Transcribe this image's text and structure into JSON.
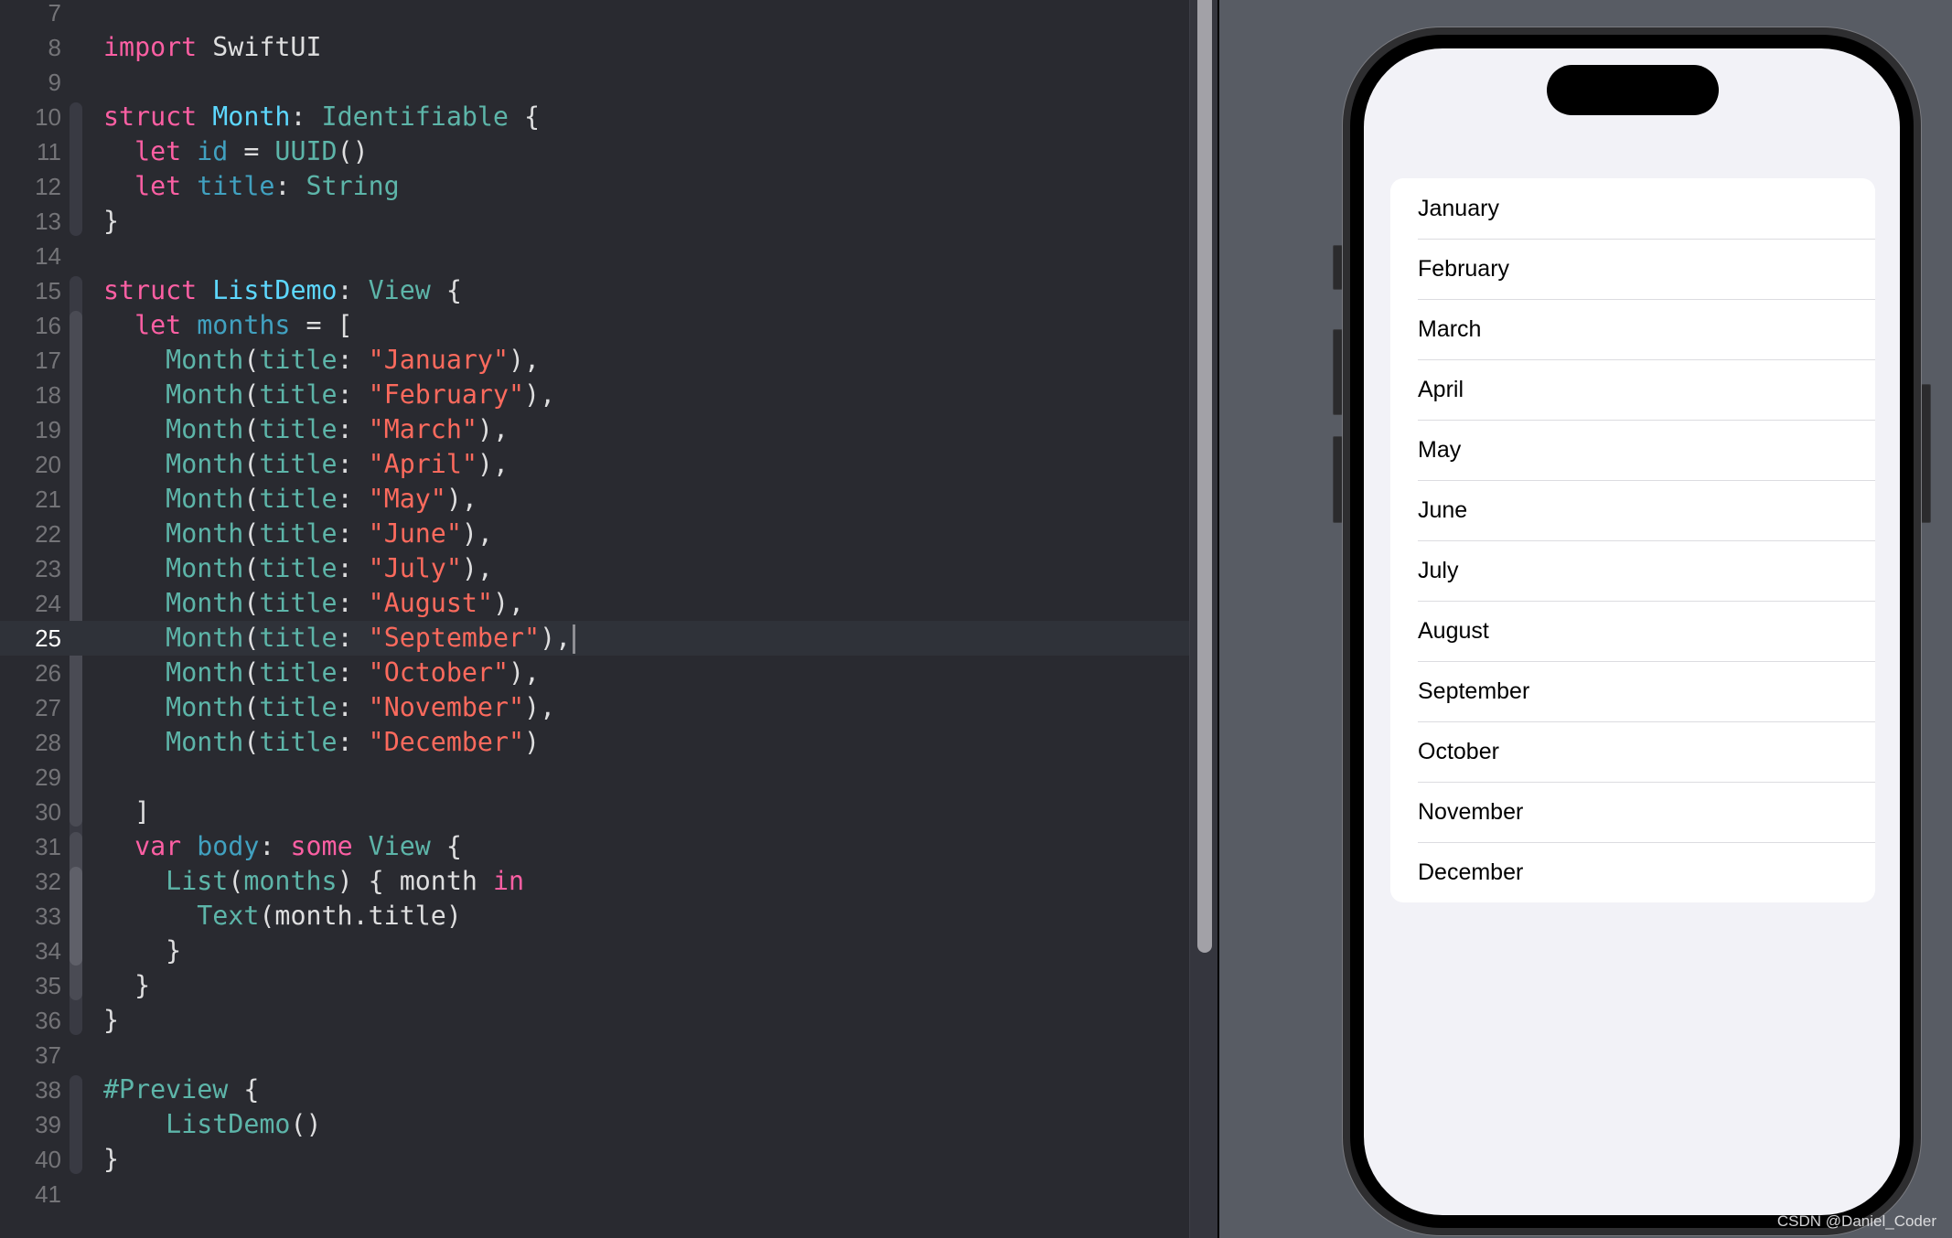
{
  "editor": {
    "current_line": 25,
    "lines": [
      {
        "n": 7,
        "tokens": []
      },
      {
        "n": 8,
        "tokens": [
          [
            "kw",
            "import"
          ],
          [
            "plain",
            " SwiftUI"
          ]
        ]
      },
      {
        "n": 9,
        "tokens": []
      },
      {
        "n": 10,
        "tokens": [
          [
            "kw",
            "struct"
          ],
          [
            "plain",
            " "
          ],
          [
            "decl",
            "Month"
          ],
          [
            "plain",
            ": "
          ],
          [
            "type",
            "Identifiable"
          ],
          [
            "plain",
            " {"
          ]
        ]
      },
      {
        "n": 11,
        "tokens": [
          [
            "plain",
            "  "
          ],
          [
            "kw",
            "let"
          ],
          [
            "plain",
            " "
          ],
          [
            "prop",
            "id"
          ],
          [
            "plain",
            " = "
          ],
          [
            "type",
            "UUID"
          ],
          [
            "plain",
            "()"
          ]
        ]
      },
      {
        "n": 12,
        "tokens": [
          [
            "plain",
            "  "
          ],
          [
            "kw",
            "let"
          ],
          [
            "plain",
            " "
          ],
          [
            "prop",
            "title"
          ],
          [
            "plain",
            ": "
          ],
          [
            "type",
            "String"
          ]
        ]
      },
      {
        "n": 13,
        "tokens": [
          [
            "plain",
            "}"
          ]
        ]
      },
      {
        "n": 14,
        "tokens": []
      },
      {
        "n": 15,
        "tokens": [
          [
            "kw",
            "struct"
          ],
          [
            "plain",
            " "
          ],
          [
            "decl",
            "ListDemo"
          ],
          [
            "plain",
            ": "
          ],
          [
            "type",
            "View"
          ],
          [
            "plain",
            " {"
          ]
        ]
      },
      {
        "n": 16,
        "tokens": [
          [
            "plain",
            "  "
          ],
          [
            "kw",
            "let"
          ],
          [
            "plain",
            " "
          ],
          [
            "prop",
            "months"
          ],
          [
            "plain",
            " = ["
          ]
        ]
      },
      {
        "n": 17,
        "tokens": [
          [
            "plain",
            "    "
          ],
          [
            "type",
            "Month"
          ],
          [
            "plain",
            "("
          ],
          [
            "type",
            "title"
          ],
          [
            "plain",
            ": "
          ],
          [
            "str",
            "\"January\""
          ],
          [
            "plain",
            "),"
          ]
        ]
      },
      {
        "n": 18,
        "tokens": [
          [
            "plain",
            "    "
          ],
          [
            "type",
            "Month"
          ],
          [
            "plain",
            "("
          ],
          [
            "type",
            "title"
          ],
          [
            "plain",
            ": "
          ],
          [
            "str",
            "\"February\""
          ],
          [
            "plain",
            "),"
          ]
        ]
      },
      {
        "n": 19,
        "tokens": [
          [
            "plain",
            "    "
          ],
          [
            "type",
            "Month"
          ],
          [
            "plain",
            "("
          ],
          [
            "type",
            "title"
          ],
          [
            "plain",
            ": "
          ],
          [
            "str",
            "\"March\""
          ],
          [
            "plain",
            "),"
          ]
        ]
      },
      {
        "n": 20,
        "tokens": [
          [
            "plain",
            "    "
          ],
          [
            "type",
            "Month"
          ],
          [
            "plain",
            "("
          ],
          [
            "type",
            "title"
          ],
          [
            "plain",
            ": "
          ],
          [
            "str",
            "\"April\""
          ],
          [
            "plain",
            "),"
          ]
        ]
      },
      {
        "n": 21,
        "tokens": [
          [
            "plain",
            "    "
          ],
          [
            "type",
            "Month"
          ],
          [
            "plain",
            "("
          ],
          [
            "type",
            "title"
          ],
          [
            "plain",
            ": "
          ],
          [
            "str",
            "\"May\""
          ],
          [
            "plain",
            "),"
          ]
        ]
      },
      {
        "n": 22,
        "tokens": [
          [
            "plain",
            "    "
          ],
          [
            "type",
            "Month"
          ],
          [
            "plain",
            "("
          ],
          [
            "type",
            "title"
          ],
          [
            "plain",
            ": "
          ],
          [
            "str",
            "\"June\""
          ],
          [
            "plain",
            "),"
          ]
        ]
      },
      {
        "n": 23,
        "tokens": [
          [
            "plain",
            "    "
          ],
          [
            "type",
            "Month"
          ],
          [
            "plain",
            "("
          ],
          [
            "type",
            "title"
          ],
          [
            "plain",
            ": "
          ],
          [
            "str",
            "\"July\""
          ],
          [
            "plain",
            "),"
          ]
        ]
      },
      {
        "n": 24,
        "tokens": [
          [
            "plain",
            "    "
          ],
          [
            "type",
            "Month"
          ],
          [
            "plain",
            "("
          ],
          [
            "type",
            "title"
          ],
          [
            "plain",
            ": "
          ],
          [
            "str",
            "\"August\""
          ],
          [
            "plain",
            "),"
          ]
        ]
      },
      {
        "n": 25,
        "tokens": [
          [
            "plain",
            "    "
          ],
          [
            "type",
            "Month"
          ],
          [
            "plain",
            "("
          ],
          [
            "type",
            "title"
          ],
          [
            "plain",
            ": "
          ],
          [
            "str",
            "\"September\""
          ],
          [
            "plain",
            "),"
          ]
        ],
        "cursor": true
      },
      {
        "n": 26,
        "tokens": [
          [
            "plain",
            "    "
          ],
          [
            "type",
            "Month"
          ],
          [
            "plain",
            "("
          ],
          [
            "type",
            "title"
          ],
          [
            "plain",
            ": "
          ],
          [
            "str",
            "\"October\""
          ],
          [
            "plain",
            "),"
          ]
        ]
      },
      {
        "n": 27,
        "tokens": [
          [
            "plain",
            "    "
          ],
          [
            "type",
            "Month"
          ],
          [
            "plain",
            "("
          ],
          [
            "type",
            "title"
          ],
          [
            "plain",
            ": "
          ],
          [
            "str",
            "\"November\""
          ],
          [
            "plain",
            "),"
          ]
        ]
      },
      {
        "n": 28,
        "tokens": [
          [
            "plain",
            "    "
          ],
          [
            "type",
            "Month"
          ],
          [
            "plain",
            "("
          ],
          [
            "type",
            "title"
          ],
          [
            "plain",
            ": "
          ],
          [
            "str",
            "\"December\""
          ],
          [
            "plain",
            ")"
          ]
        ]
      },
      {
        "n": 29,
        "tokens": []
      },
      {
        "n": 30,
        "tokens": [
          [
            "plain",
            "  ]"
          ]
        ]
      },
      {
        "n": 31,
        "tokens": [
          [
            "plain",
            "  "
          ],
          [
            "kw",
            "var"
          ],
          [
            "plain",
            " "
          ],
          [
            "prop",
            "body"
          ],
          [
            "plain",
            ": "
          ],
          [
            "kw",
            "some"
          ],
          [
            "plain",
            " "
          ],
          [
            "type",
            "View"
          ],
          [
            "plain",
            " {"
          ]
        ]
      },
      {
        "n": 32,
        "tokens": [
          [
            "plain",
            "    "
          ],
          [
            "type",
            "List"
          ],
          [
            "plain",
            "("
          ],
          [
            "type",
            "months"
          ],
          [
            "plain",
            ") { month "
          ],
          [
            "kw",
            "in"
          ]
        ]
      },
      {
        "n": 33,
        "tokens": [
          [
            "plain",
            "      "
          ],
          [
            "type",
            "Text"
          ],
          [
            "plain",
            "(month.title)"
          ]
        ]
      },
      {
        "n": 34,
        "tokens": [
          [
            "plain",
            "    }"
          ]
        ]
      },
      {
        "n": 35,
        "tokens": [
          [
            "plain",
            "  }"
          ]
        ]
      },
      {
        "n": 36,
        "tokens": [
          [
            "plain",
            "}"
          ]
        ]
      },
      {
        "n": 37,
        "tokens": []
      },
      {
        "n": 38,
        "tokens": [
          [
            "type",
            "#Preview"
          ],
          [
            "plain",
            " {"
          ]
        ]
      },
      {
        "n": 39,
        "tokens": [
          [
            "plain",
            "    "
          ],
          [
            "type",
            "ListDemo"
          ],
          [
            "plain",
            "()"
          ]
        ]
      },
      {
        "n": 40,
        "tokens": [
          [
            "plain",
            "}"
          ]
        ]
      },
      {
        "n": 41,
        "tokens": []
      }
    ],
    "fold_ribbons": [
      {
        "from": 10,
        "to": 13,
        "level": 1
      },
      {
        "from": 15,
        "to": 36,
        "level": 1
      },
      {
        "from": 16,
        "to": 30,
        "level": 2
      },
      {
        "from": 31,
        "to": 35,
        "level": 2
      },
      {
        "from": 32,
        "to": 34,
        "level": 3
      },
      {
        "from": 38,
        "to": 40,
        "level": 1
      }
    ]
  },
  "preview": {
    "list_items": [
      "January",
      "February",
      "March",
      "April",
      "May",
      "June",
      "July",
      "August",
      "September",
      "October",
      "November",
      "December"
    ]
  },
  "watermark": "CSDN @Daniel_Coder",
  "colors": {
    "keyword": "#fc5fa3",
    "declaration": "#5dd8ff",
    "type": "#5db5a9",
    "property": "#41a1c0",
    "string": "#fc6a5d",
    "editor_background": "#292a30",
    "current_line_background": "#2f3239",
    "preview_background": "#585c64",
    "screen_background": "#f2f2f7"
  }
}
